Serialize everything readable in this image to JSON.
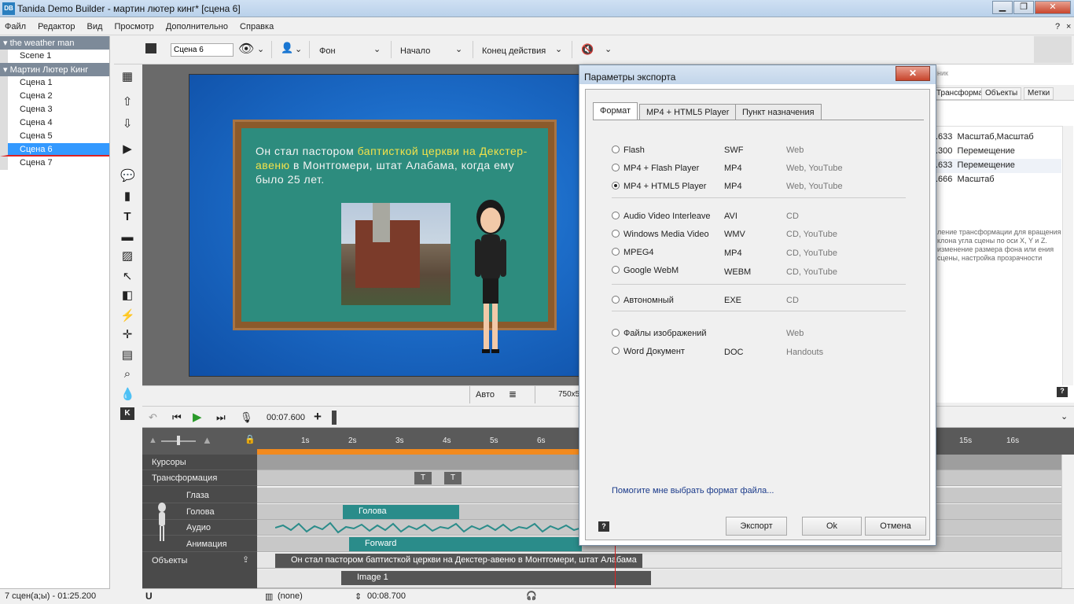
{
  "window": {
    "title": "Tanida Demo Builder - мартин лютер кинг* [сцена 6]",
    "logo": "DB",
    "controls": [
      "▁",
      "❐",
      "✕"
    ]
  },
  "menu": [
    "Файл",
    "Редактор",
    "Вид",
    "Просмотр",
    "Дополнительно",
    "Справка"
  ],
  "menu_right": [
    "?",
    "×"
  ],
  "project_tree": {
    "group1": "the weather man",
    "group1_items": [
      "Scene 1"
    ],
    "group2": "Мартин Лютер Кинг",
    "group2_items": [
      "Сцена 1",
      "Сцена 2",
      "Сцена 3",
      "Сцена 4",
      "Сцена 5",
      "Сцена 6",
      "Сцена 7"
    ],
    "selected": "Сцена 6"
  },
  "status_left": "7 сцен(а;ы) - 01:25.200",
  "toolbar": {
    "scene_name": "Сцена 6",
    "background": "Фон",
    "start": "Начало",
    "end_action": "Конец действия"
  },
  "slide": {
    "text_normal_1": "Он стал пастором ",
    "text_highlight": "баптисткой церкви на Декстер-авеню",
    "text_normal_2": " в Монтгомери, штат Алабама, когда ему было 25 лет."
  },
  "canvas_status": {
    "mode": "Авто",
    "size": "750x5"
  },
  "right_panel": {
    "tabs": [
      "Трансформация",
      "Объекты",
      "Метки"
    ],
    "header_fragment": "ник",
    "rows": [
      {
        "value": ".633",
        "label": "Масштаб,Масштаб"
      },
      {
        "value": ".300",
        "label": "Перемещение"
      },
      {
        "value": ".633",
        "label": "Перемещение"
      },
      {
        "value": ".666",
        "label": "Масштаб"
      }
    ],
    "description": "ление трансформации для вращения клона угла сцены по оси X, Y и Z. изменение размера фона или ения сцены, настройка прозрачности"
  },
  "time_controls": {
    "time": "00:07.600"
  },
  "ruler": {
    "ticks": [
      "1s",
      "2s",
      "3s",
      "4s",
      "5s",
      "6s",
      "15s",
      "16s"
    ]
  },
  "tracks": {
    "cursors": "Курсоры",
    "transform": "Трансформация",
    "eyes": "Глаза",
    "head": "Голова",
    "audio": "Аудио",
    "animation": "Анимация",
    "objects": "Объекты"
  },
  "clips": {
    "kf_label": "T",
    "head": "Голова",
    "animation": "Forward",
    "text_object": "Он стал пастором баптисткой церкви на Декстер-авеню в Монтгомери, штат Алабама",
    "image_object": "Image 1"
  },
  "bottom_bar": {
    "none": "(none)",
    "time": "00:08.700"
  },
  "dialog": {
    "title": "Параметры экспорта",
    "tabs": [
      "Формат",
      "MP4 + HTML5 Player",
      "Пункт назначения"
    ],
    "options": [
      {
        "name": "Flash",
        "ext": "SWF",
        "use": "Web",
        "selected": false
      },
      {
        "name": "MP4 + Flash Player",
        "ext": "MP4",
        "use": "Web, YouTube",
        "selected": false
      },
      {
        "name": "MP4 + HTML5 Player",
        "ext": "MP4",
        "use": "Web, YouTube",
        "selected": true
      },
      {
        "name": "Audio Video Interleave",
        "ext": "AVI",
        "use": "CD",
        "selected": false
      },
      {
        "name": "Windows Media Video",
        "ext": "WMV",
        "use": "CD, YouTube",
        "selected": false
      },
      {
        "name": "MPEG4",
        "ext": "MP4",
        "use": "CD, YouTube",
        "selected": false
      },
      {
        "name": "Google WebM",
        "ext": "WEBM",
        "use": "CD, YouTube",
        "selected": false
      },
      {
        "name": "Автономный",
        "ext": "EXE",
        "use": "CD",
        "selected": false
      },
      {
        "name": "Файлы изображений",
        "ext": "",
        "use": "Web",
        "selected": false
      },
      {
        "name": "Word Документ",
        "ext": "DOC",
        "use": "Handouts",
        "selected": false
      }
    ],
    "help_link": "Помогите мне выбрать формат файла...",
    "help_icon": "?",
    "buttons": {
      "export": "Экспорт",
      "ok": "Ok",
      "cancel": "Отмена"
    }
  }
}
